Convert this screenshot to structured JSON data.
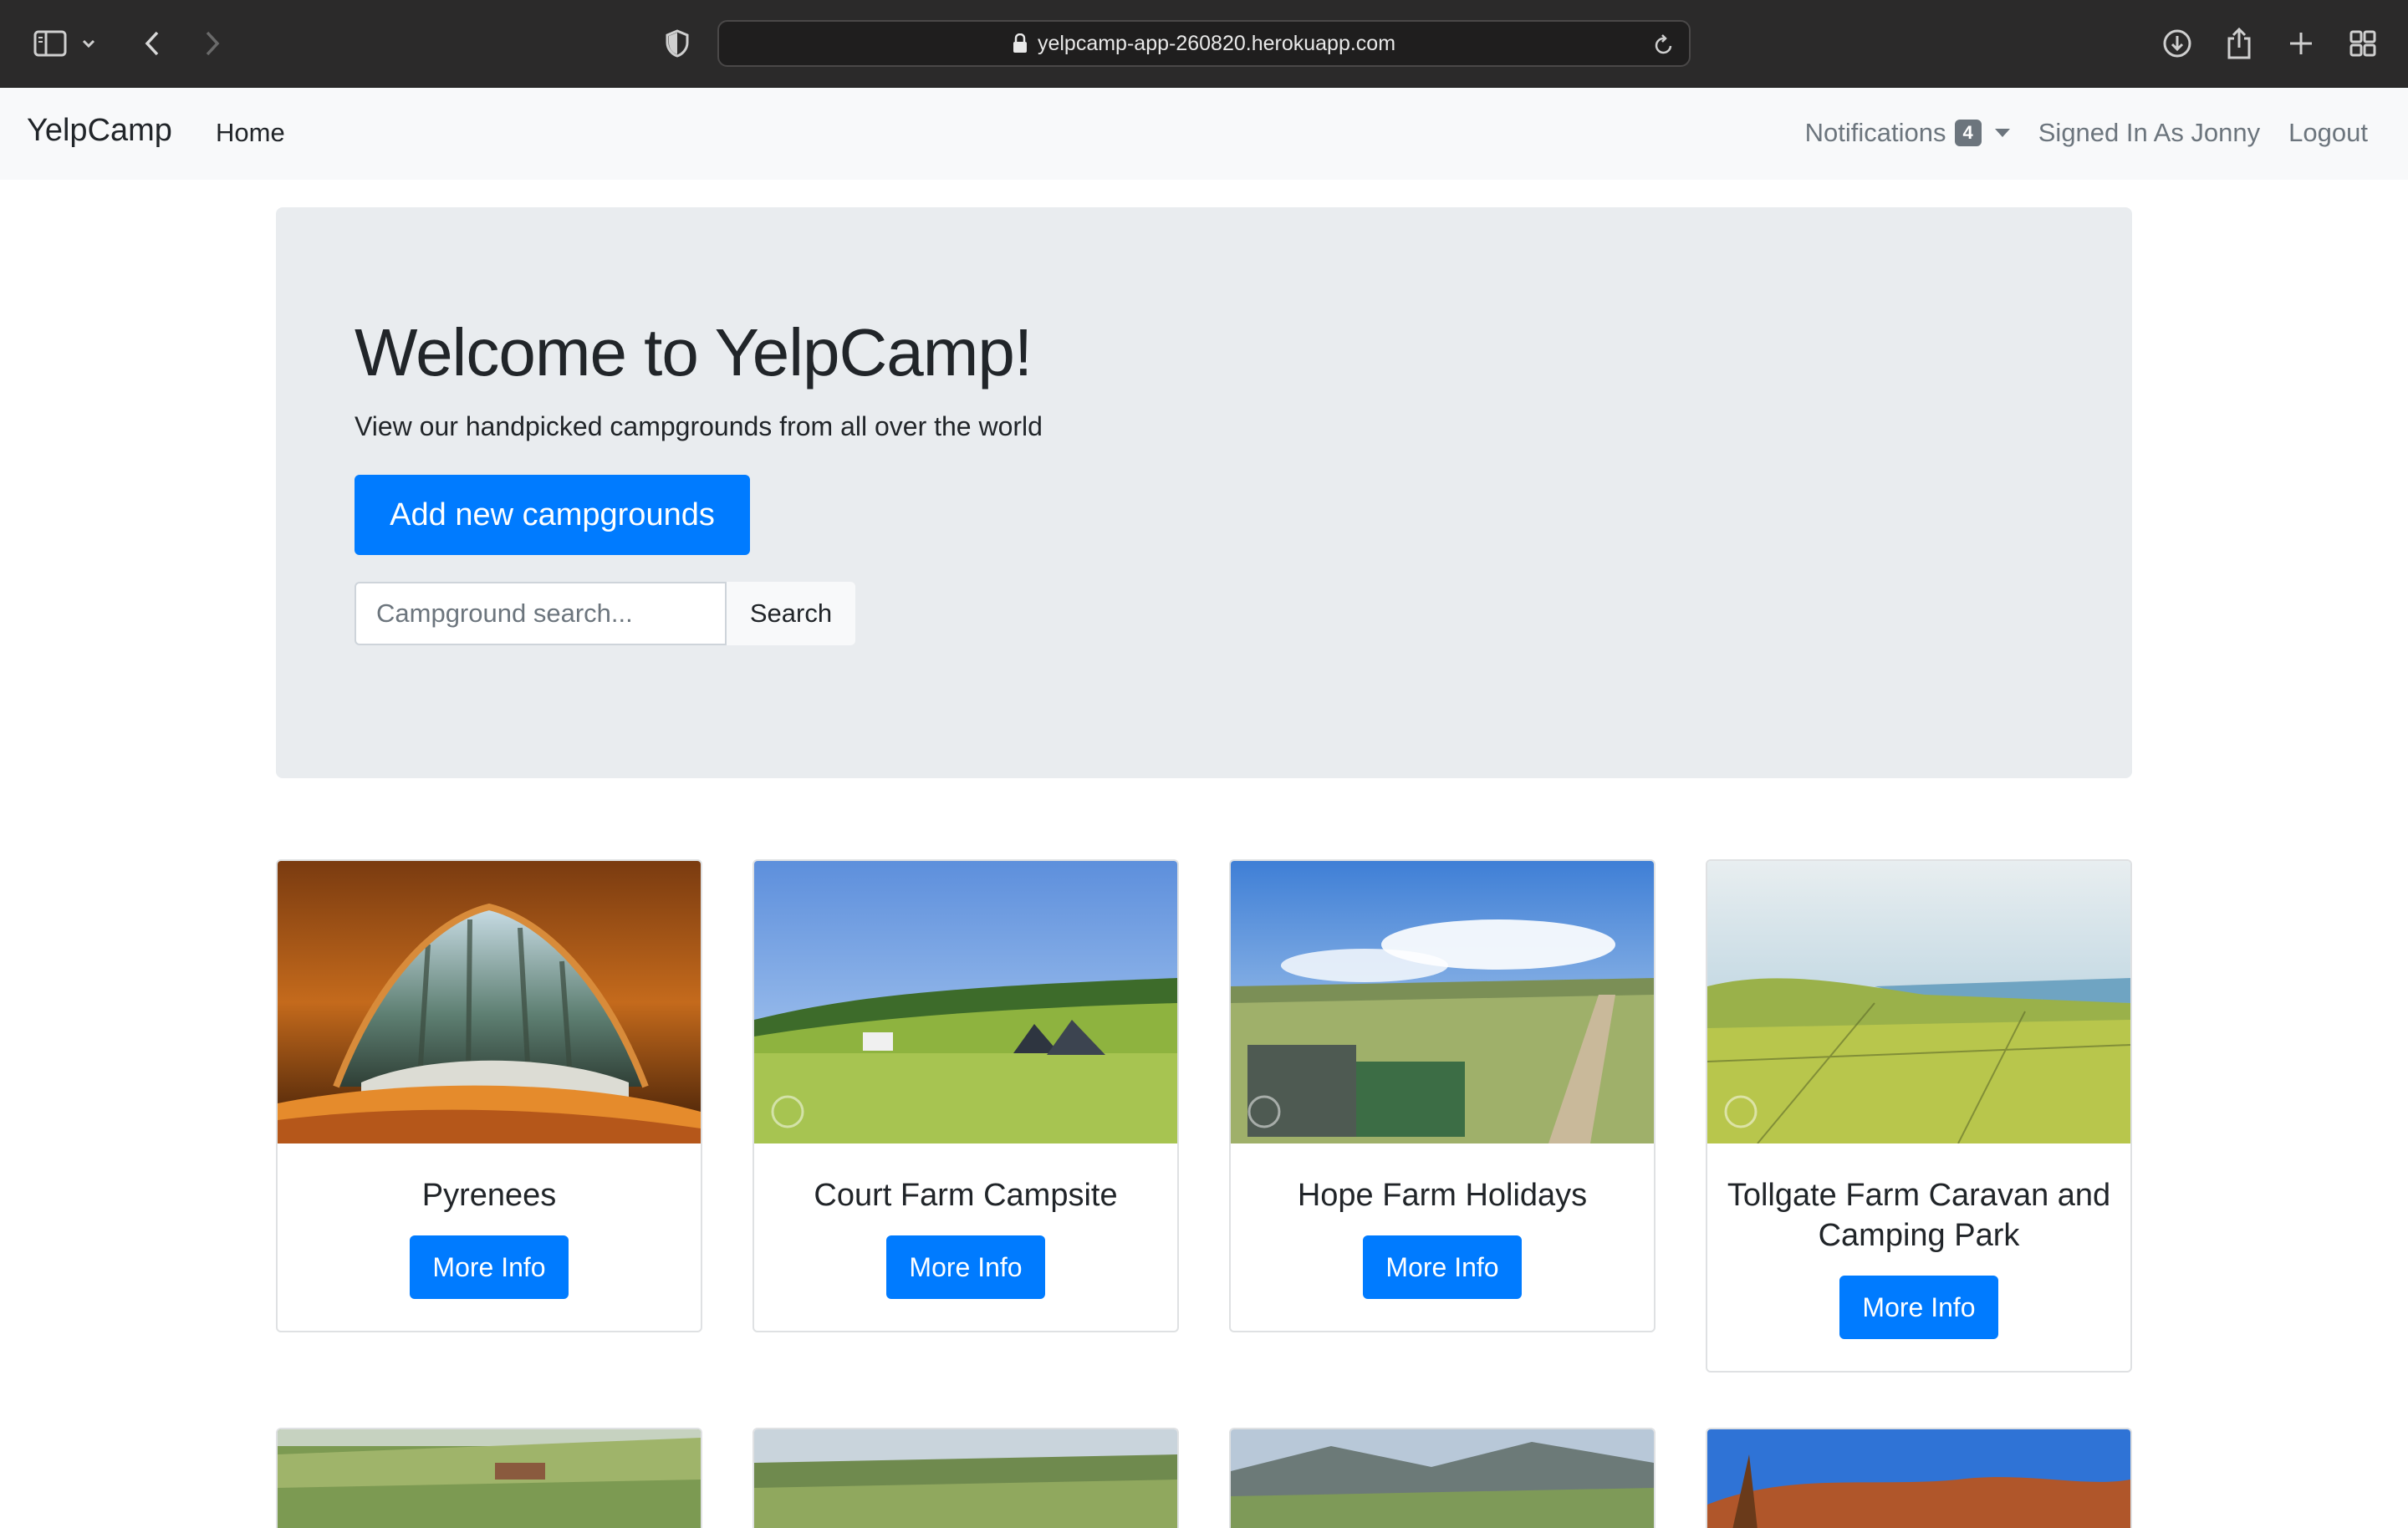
{
  "browser": {
    "url": "yelpcamp-app-260820.herokuapp.com",
    "icons": [
      "sidebar-icon",
      "chevron-down-icon",
      "back-icon",
      "forward-icon",
      "shield-icon",
      "lock-icon",
      "reload-icon",
      "download-icon",
      "share-icon",
      "plus-icon",
      "tab-overview-icon"
    ]
  },
  "navbar": {
    "brand": "YelpCamp",
    "home": "Home",
    "notifications_label": "Notifications",
    "notifications_count": "4",
    "signed_in": "Signed In As Jonny",
    "logout": "Logout"
  },
  "jumbotron": {
    "title": "Welcome to YelpCamp!",
    "lead": "View our handpicked campgrounds from all over the world",
    "add_button": "Add new campgrounds",
    "search_placeholder": "Campground search...",
    "search_button": "Search"
  },
  "campgrounds": [
    {
      "name": "Pyrenees",
      "button": "More Info"
    },
    {
      "name": "Court Farm Campsite",
      "button": "More Info"
    },
    {
      "name": "Hope Farm Holidays",
      "button": "More Info"
    },
    {
      "name": "Tollgate Farm Caravan and Camping Park",
      "button": "More Info"
    }
  ],
  "colors": {
    "primary": "#007bff",
    "jumbotron_bg": "#e9ecef",
    "navbar_bg": "#f8f9fa",
    "chrome_bg": "#2b2a2a"
  }
}
